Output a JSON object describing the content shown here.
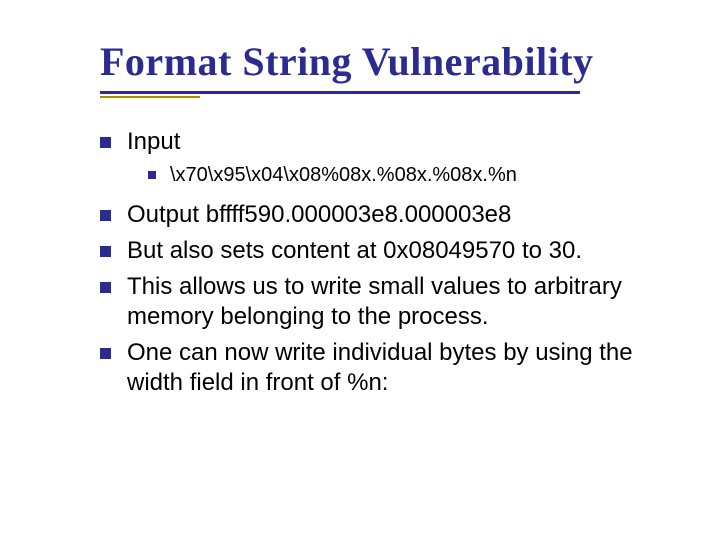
{
  "title": "Format String Vulnerability",
  "bullets": {
    "b0": {
      "text": "Input"
    },
    "sub0": {
      "text": "\\x70\\x95\\x04\\x08%08x.%08x.%08x.%n"
    },
    "b1": {
      "text": "Output bffff590.000003e8.000003e8"
    },
    "b2": {
      "text": "But also sets content at 0x08049570 to 30."
    },
    "b3": {
      "text": "This allows us to write small values to arbitrary memory belonging to the process."
    },
    "b4": {
      "text": "One can now write individual bytes by using the width field in front of %n:"
    }
  }
}
